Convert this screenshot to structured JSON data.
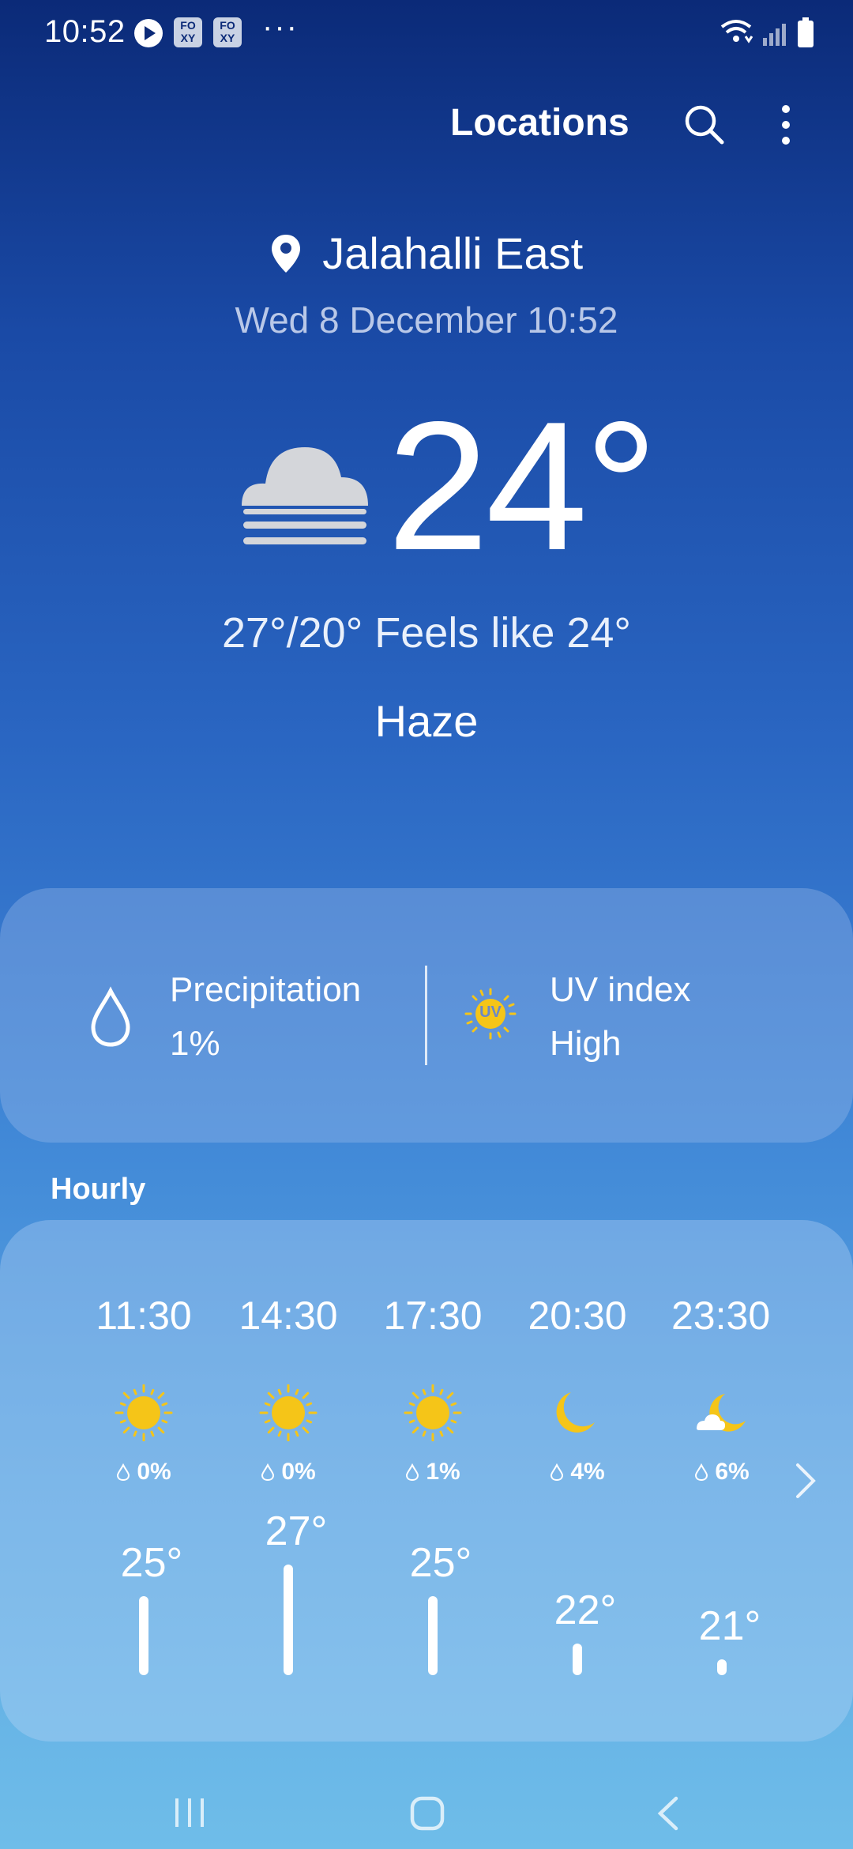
{
  "status_bar": {
    "time": "10:52",
    "app_badges": [
      "FO XY",
      "FO XY"
    ],
    "more": "···"
  },
  "app_bar": {
    "locations_label": "Locations"
  },
  "location": {
    "name": "Jalahalli East",
    "datetime": "Wed 8 December 10:52"
  },
  "current": {
    "temperature": "24°",
    "hi_lo_feels": "27°/20° Feels like 24°",
    "condition": "Haze"
  },
  "details": {
    "precipitation_label": "Precipitation",
    "precipitation_value": "1%",
    "uv_label": "UV index",
    "uv_value": "High",
    "uv_badge": "UV"
  },
  "hourly": {
    "title": "Hourly",
    "items": [
      {
        "time": "11:30",
        "icon": "sun-icon",
        "rain": "0%",
        "temp": "25°",
        "temp_value": 25
      },
      {
        "time": "14:30",
        "icon": "sun-icon",
        "rain": "0%",
        "temp": "27°",
        "temp_value": 27
      },
      {
        "time": "17:30",
        "icon": "sun-icon",
        "rain": "1%",
        "temp": "25°",
        "temp_value": 25
      },
      {
        "time": "20:30",
        "icon": "moon-icon",
        "rain": "4%",
        "temp": "22°",
        "temp_value": 22
      },
      {
        "time": "23:30",
        "icon": "moon-cloud-icon",
        "rain": "6%",
        "temp": "21°",
        "temp_value": 21
      }
    ]
  },
  "colors": {
    "sun": "#f5c518",
    "background_top": "#0b2a78",
    "background_bottom": "#6fbde9"
  }
}
